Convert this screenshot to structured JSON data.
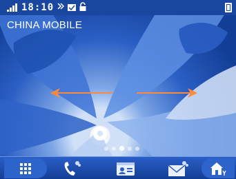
{
  "status_bar": {
    "time": "18:10",
    "icons": [
      "signal-icon",
      "data-transfer-icon",
      "message-icon",
      "lock-icon",
      "battery-icon"
    ]
  },
  "home": {
    "carrier": "CHINA MOBILE",
    "swipe_hint": [
      "arrow-left-icon",
      "arrow-right-icon"
    ],
    "pages": {
      "count": 5,
      "current": 3
    }
  },
  "dock": {
    "items": [
      "app-drawer-icon",
      "phone-icon",
      "contacts-icon",
      "messages-icon",
      "home-menu-icon"
    ]
  },
  "colors": {
    "status_bar": "#1947a0",
    "dock": "#1f4fb0",
    "arrow": "#ff8a3d",
    "text": "#ffffff"
  }
}
